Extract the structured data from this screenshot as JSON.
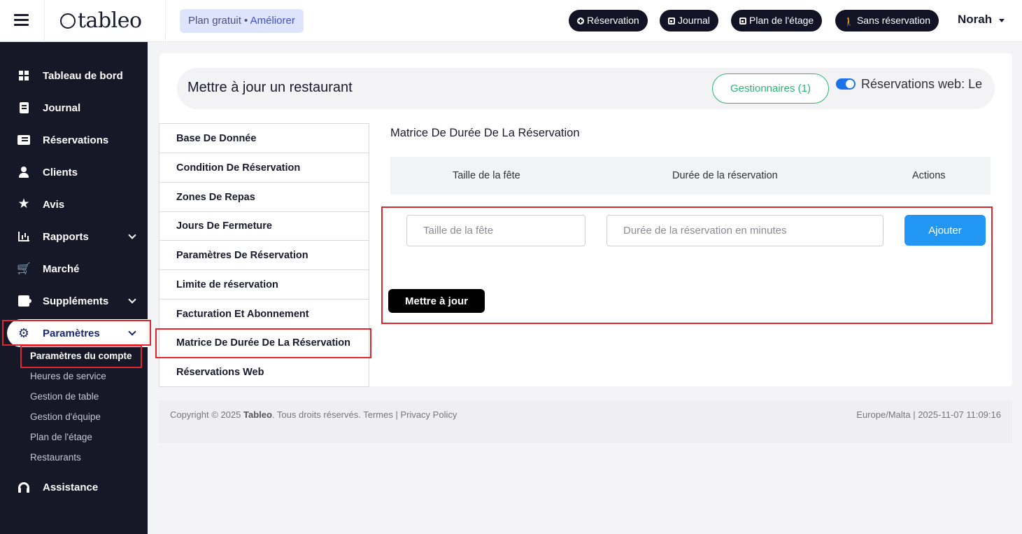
{
  "brand": {
    "name": "tableo"
  },
  "plan": {
    "label": "Plan gratuit",
    "separator": " • ",
    "upgrade": "Améliorer"
  },
  "topnav": {
    "reservation": "Réservation",
    "journal": "Journal",
    "floor_plan": "Plan de l'étage",
    "walk_in": "Sans réservation"
  },
  "user": {
    "name": "Norah"
  },
  "sidebar": {
    "items": [
      {
        "label": "Tableau de bord",
        "icon": "dashboard-icon"
      },
      {
        "label": "Journal",
        "icon": "book-icon"
      },
      {
        "label": "Réservations",
        "icon": "list-icon"
      },
      {
        "label": "Clients",
        "icon": "user-icon"
      },
      {
        "label": "Avis",
        "icon": "star-icon"
      },
      {
        "label": "Rapports",
        "icon": "chart-icon"
      },
      {
        "label": "Marché",
        "icon": "cart-icon"
      },
      {
        "label": "Suppléments",
        "icon": "puzzle-icon"
      },
      {
        "label": "Paramètres",
        "icon": "gear-icon"
      },
      {
        "label": "Assistance",
        "icon": "headset-icon"
      }
    ],
    "sub_items": [
      {
        "label": "Paramètres du compte"
      },
      {
        "label": "Heures de service"
      },
      {
        "label": "Gestion de table"
      },
      {
        "label": "Gestion d'équipe"
      },
      {
        "label": "Plan de l'étage"
      },
      {
        "label": "Restaurants"
      }
    ]
  },
  "page": {
    "title": "Mettre à jour un restaurant",
    "managers_button": "Gestionnaires (1)",
    "web_reservations_label": "Réservations web: Le"
  },
  "settings_menu": {
    "items": [
      {
        "label": "Base De Donnée"
      },
      {
        "label": "Condition De Réservation"
      },
      {
        "label": "Zones De Repas"
      },
      {
        "label": "Jours De Fermeture"
      },
      {
        "label": "Paramètres De Réservation"
      },
      {
        "label": "Limite de réservation"
      },
      {
        "label": "Facturation Et Abonnement"
      },
      {
        "label": "Matrice De Durée De La Réservation"
      },
      {
        "label": "Réservations Web"
      }
    ]
  },
  "matrix": {
    "title": "Matrice De Durée De La Réservation",
    "columns": [
      "Taille de la fête",
      "Durée de la réservation",
      "Actions"
    ],
    "party_size_placeholder": "Taille de la fête",
    "duration_placeholder": "Durée de la réservation en minutes",
    "add_button": "Ajouter",
    "update_button": "Mettre à jour"
  },
  "footer": {
    "copyright": "Copyright © 2025",
    "brand": "Tableo",
    "rights": ". Tous droits réservés. Termes | Privacy Policy",
    "timezone_time": "Europe/Malta | 2025-11-07 11:09:16"
  },
  "colors": {
    "sidebar_bg": "#161827",
    "highlight_red": "#e0262d",
    "accent_blue": "#2196f3",
    "managers_green": "#2bb673"
  }
}
